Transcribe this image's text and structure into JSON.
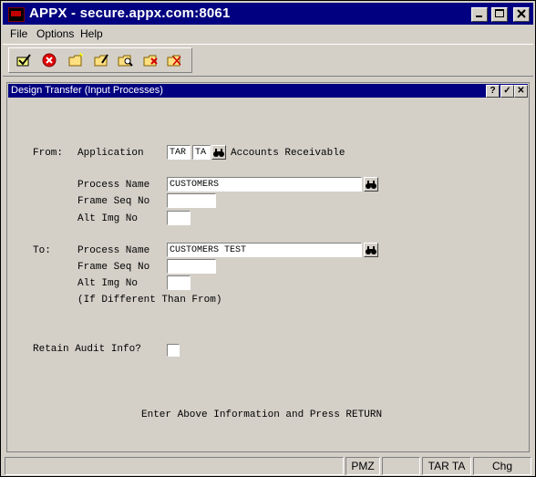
{
  "window": {
    "title": "APPX - secure.appx.com:8061"
  },
  "menu": {
    "items": [
      "File",
      "Options",
      "Help"
    ]
  },
  "child": {
    "title": "Design Transfer (Input Processes)",
    "buttons": [
      "?",
      "✓",
      "✕"
    ]
  },
  "form": {
    "from_label": "From:",
    "application_label": "Application",
    "app_code": "TAR",
    "app_version": "TA",
    "app_name": "Accounts Receivable",
    "process_name_label": "Process Name",
    "from_process_name": "CUSTOMERS",
    "frame_seq_label": "Frame Seq No",
    "from_frame_seq": "",
    "alt_img_label": "Alt Img No",
    "from_alt_img": "",
    "to_label": "To:",
    "to_process_name": "CUSTOMERS TEST",
    "to_frame_seq": "",
    "to_alt_img": "",
    "different_note": "(If Different Than From)",
    "retain_audit_label": "Retain Audit Info?",
    "retain_audit_checked": false,
    "instruction": "Enter Above Information and Press RETURN"
  },
  "status": {
    "cells": [
      "",
      "PMZ",
      "",
      "TAR TA",
      "Chg"
    ]
  },
  "colors": {
    "titlebar": "#000080",
    "background": "#d4d0c8"
  }
}
